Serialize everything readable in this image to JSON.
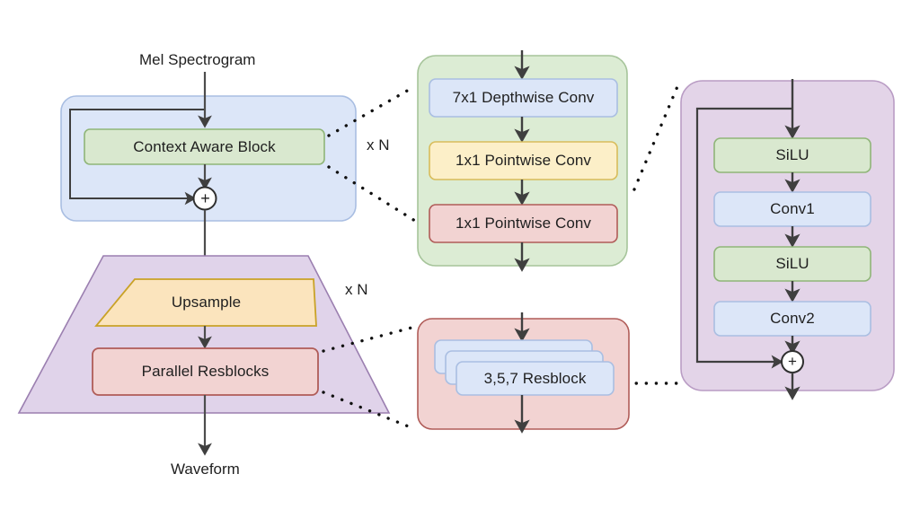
{
  "diagram": {
    "title": "Neural vocoder architecture block diagram",
    "io_labels": {
      "input": "Mel Spectrogram",
      "output": "Waveform"
    },
    "repeat_labels": {
      "context_stack": "x N",
      "upsample_stack": "x N"
    },
    "operators": {
      "add": "+"
    },
    "main_column": {
      "context_panel": {
        "name": "Context Aware Block container",
        "fill": "#dce6f8",
        "stroke": "#a9bee2",
        "blocks": [
          {
            "label": "Context Aware Block",
            "fill": "#d9e8cf",
            "stroke": "#8fb578"
          }
        ]
      },
      "generator_panel": {
        "name": "Upsample / Resblock trapezoid",
        "fill": "#e0d3ea",
        "stroke": "#9b7fb0",
        "blocks": [
          {
            "label": "Upsample",
            "fill": "#fbe4bd",
            "stroke": "#c9a227",
            "shape": "trapezoid"
          },
          {
            "label": "Parallel Resblocks",
            "fill": "#f2d3d2",
            "stroke": "#b05c58",
            "shape": "rect"
          }
        ]
      }
    },
    "context_detail": {
      "name": "Context Aware Block expansion",
      "fill": "#dcecd4",
      "stroke": "#a6c49a",
      "blocks": [
        {
          "label": "7x1 Depthwise Conv",
          "fill": "#dce6f8",
          "stroke": "#a9bee2"
        },
        {
          "label": "1x1 Pointwise Conv",
          "fill": "#fcefc8",
          "stroke": "#d8bc5a"
        },
        {
          "label": "1x1 Pointwise Conv",
          "fill": "#f2d3d2",
          "stroke": "#b05c58"
        }
      ]
    },
    "parallel_resblock_detail": {
      "name": "Parallel Resblocks expansion",
      "fill": "#f2d3d2",
      "stroke": "#b05c58",
      "stack_count": 3,
      "blocks": [
        {
          "label": "3,5,7 Resblock",
          "fill": "#dce6f8",
          "stroke": "#a9bee2"
        }
      ]
    },
    "resblock_detail": {
      "name": "Resblock expansion",
      "fill": "#e3d4e8",
      "stroke": "#b99cc4",
      "blocks": [
        {
          "label": "SiLU",
          "fill": "#d9e8cf",
          "stroke": "#8fb578"
        },
        {
          "label": "Conv1",
          "fill": "#dce6f8",
          "stroke": "#a9bee2"
        },
        {
          "label": "SiLU",
          "fill": "#d9e8cf",
          "stroke": "#8fb578"
        },
        {
          "label": "Conv2",
          "fill": "#dce6f8",
          "stroke": "#a9bee2"
        }
      ]
    },
    "colors": {
      "arrow": "#4d4d4d",
      "skip_line": "#3f3f3f",
      "text": "#1f1f1f",
      "background": "#ffffff",
      "dotted_connector": "#111111"
    }
  }
}
